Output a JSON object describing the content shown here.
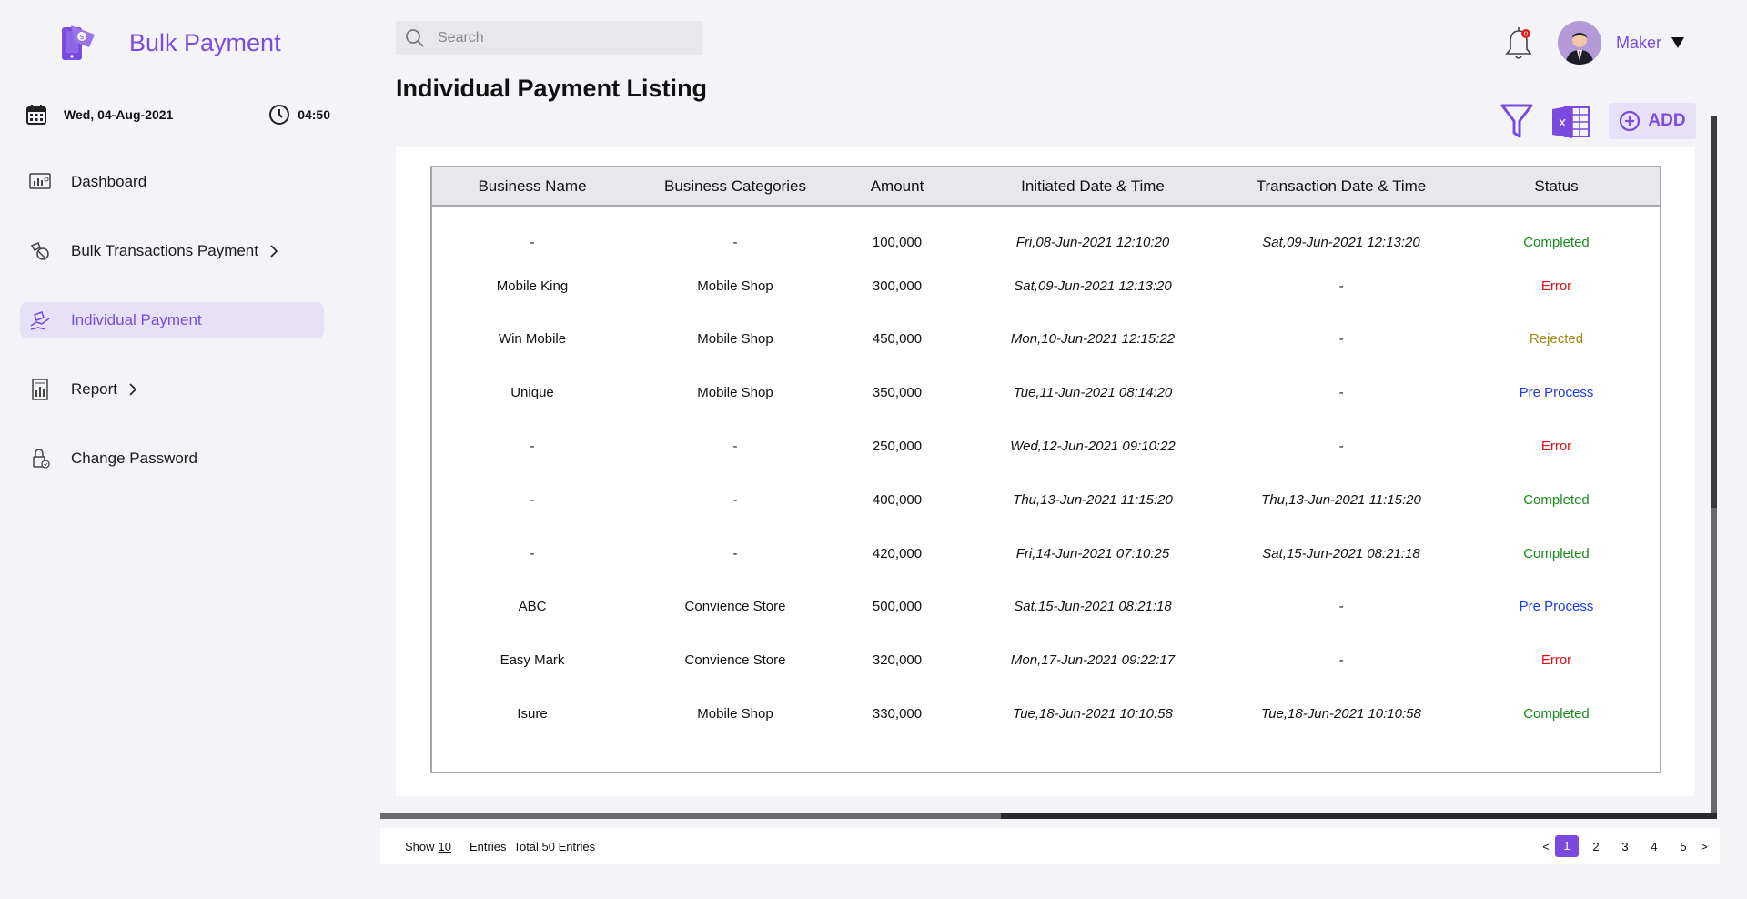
{
  "app": {
    "title": "Bulk Payment"
  },
  "datebar": {
    "date": "Wed, 04-Aug-2021",
    "time": "04:50"
  },
  "sidebar": {
    "items": [
      {
        "label": "Dashboard",
        "icon": "dashboard-icon"
      },
      {
        "label": "Bulk Transactions Payment",
        "icon": "bulk-transactions-icon"
      },
      {
        "label": "Individual Payment",
        "icon": "individual-payment-icon",
        "active": true
      },
      {
        "label": "Report",
        "icon": "report-icon"
      },
      {
        "label": "Change Password",
        "icon": "change-password-icon"
      }
    ]
  },
  "search": {
    "placeholder": "Search"
  },
  "user": {
    "name": "Maker",
    "notification_count": "0"
  },
  "main": {
    "title": "Individual Payment Listing",
    "add_label": "ADD"
  },
  "table": {
    "headers": [
      "Business Name",
      "Business Categories",
      "Amount",
      "Initiated Date & Time",
      "Transaction Date & Time",
      "Status"
    ],
    "rows": [
      {
        "name": "-",
        "category": "-",
        "amount": "100,000",
        "initiated": "Fri,08-Jun-2021 12:10:20",
        "transaction": "Sat,09-Jun-2021 12:13:20",
        "status": "Completed"
      },
      {
        "name": "Mobile King",
        "category": "Mobile Shop",
        "amount": "300,000",
        "initiated": "Sat,09-Jun-2021 12:13:20",
        "transaction": "-",
        "status": "Error"
      },
      {
        "name": "Win Mobile",
        "category": "Mobile Shop",
        "amount": "450,000",
        "initiated": "Mon,10-Jun-2021 12:15:22",
        "transaction": "-",
        "status": "Rejected"
      },
      {
        "name": "Unique",
        "category": "Mobile Shop",
        "amount": "350,000",
        "initiated": "Tue,11-Jun-2021 08:14:20",
        "transaction": "-",
        "status": "Pre Process"
      },
      {
        "name": "-",
        "category": "-",
        "amount": "250,000",
        "initiated": "Wed,12-Jun-2021 09:10:22",
        "transaction": "-",
        "status": "Error"
      },
      {
        "name": "-",
        "category": "-",
        "amount": "400,000",
        "initiated": "Thu,13-Jun-2021 11:15:20",
        "transaction": "Thu,13-Jun-2021 11:15:20",
        "status": "Completed"
      },
      {
        "name": "-",
        "category": "-",
        "amount": "420,000",
        "initiated": "Fri,14-Jun-2021 07:10:25",
        "transaction": "Sat,15-Jun-2021 08:21:18",
        "status": "Completed"
      },
      {
        "name": "ABC",
        "category": "Convience Store",
        "amount": "500,000",
        "initiated": "Sat,15-Jun-2021 08:21:18",
        "transaction": "-",
        "status": "Pre Process"
      },
      {
        "name": "Easy Mark",
        "category": "Convience Store",
        "amount": "320,000",
        "initiated": "Mon,17-Jun-2021 09:22:17",
        "transaction": "-",
        "status": "Error"
      },
      {
        "name": "Isure",
        "category": "Mobile Shop",
        "amount": "330,000",
        "initiated": "Tue,18-Jun-2021 10:10:58",
        "transaction": "Tue,18-Jun-2021 10:10:58",
        "status": "Completed"
      }
    ]
  },
  "footer": {
    "show_label": "Show",
    "page_size": "10",
    "entries_label": "Entries",
    "total_label": "Total 50 Entries",
    "prev": "<",
    "next": ">",
    "pages": [
      "1",
      "2",
      "3",
      "4",
      "5"
    ],
    "current_page": "1"
  },
  "colors": {
    "accent": "#7b4be0",
    "completed": "#1a8a1a",
    "error": "#e01010",
    "rejected": "#a08a10",
    "pre_process": "#1a3be0"
  }
}
